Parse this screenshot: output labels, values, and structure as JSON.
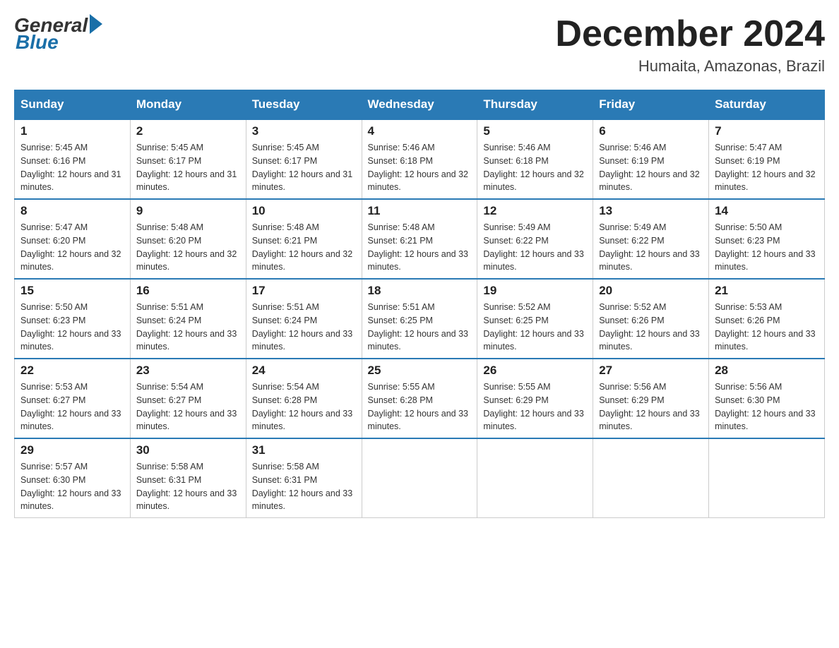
{
  "header": {
    "logo": {
      "general": "General",
      "blue": "Blue"
    },
    "title": "December 2024",
    "location": "Humaita, Amazonas, Brazil"
  },
  "calendar": {
    "days_of_week": [
      "Sunday",
      "Monday",
      "Tuesday",
      "Wednesday",
      "Thursday",
      "Friday",
      "Saturday"
    ],
    "weeks": [
      [
        {
          "day": "1",
          "sunrise": "5:45 AM",
          "sunset": "6:16 PM",
          "daylight": "12 hours and 31 minutes."
        },
        {
          "day": "2",
          "sunrise": "5:45 AM",
          "sunset": "6:17 PM",
          "daylight": "12 hours and 31 minutes."
        },
        {
          "day": "3",
          "sunrise": "5:45 AM",
          "sunset": "6:17 PM",
          "daylight": "12 hours and 31 minutes."
        },
        {
          "day": "4",
          "sunrise": "5:46 AM",
          "sunset": "6:18 PM",
          "daylight": "12 hours and 32 minutes."
        },
        {
          "day": "5",
          "sunrise": "5:46 AM",
          "sunset": "6:18 PM",
          "daylight": "12 hours and 32 minutes."
        },
        {
          "day": "6",
          "sunrise": "5:46 AM",
          "sunset": "6:19 PM",
          "daylight": "12 hours and 32 minutes."
        },
        {
          "day": "7",
          "sunrise": "5:47 AM",
          "sunset": "6:19 PM",
          "daylight": "12 hours and 32 minutes."
        }
      ],
      [
        {
          "day": "8",
          "sunrise": "5:47 AM",
          "sunset": "6:20 PM",
          "daylight": "12 hours and 32 minutes."
        },
        {
          "day": "9",
          "sunrise": "5:48 AM",
          "sunset": "6:20 PM",
          "daylight": "12 hours and 32 minutes."
        },
        {
          "day": "10",
          "sunrise": "5:48 AM",
          "sunset": "6:21 PM",
          "daylight": "12 hours and 32 minutes."
        },
        {
          "day": "11",
          "sunrise": "5:48 AM",
          "sunset": "6:21 PM",
          "daylight": "12 hours and 33 minutes."
        },
        {
          "day": "12",
          "sunrise": "5:49 AM",
          "sunset": "6:22 PM",
          "daylight": "12 hours and 33 minutes."
        },
        {
          "day": "13",
          "sunrise": "5:49 AM",
          "sunset": "6:22 PM",
          "daylight": "12 hours and 33 minutes."
        },
        {
          "day": "14",
          "sunrise": "5:50 AM",
          "sunset": "6:23 PM",
          "daylight": "12 hours and 33 minutes."
        }
      ],
      [
        {
          "day": "15",
          "sunrise": "5:50 AM",
          "sunset": "6:23 PM",
          "daylight": "12 hours and 33 minutes."
        },
        {
          "day": "16",
          "sunrise": "5:51 AM",
          "sunset": "6:24 PM",
          "daylight": "12 hours and 33 minutes."
        },
        {
          "day": "17",
          "sunrise": "5:51 AM",
          "sunset": "6:24 PM",
          "daylight": "12 hours and 33 minutes."
        },
        {
          "day": "18",
          "sunrise": "5:51 AM",
          "sunset": "6:25 PM",
          "daylight": "12 hours and 33 minutes."
        },
        {
          "day": "19",
          "sunrise": "5:52 AM",
          "sunset": "6:25 PM",
          "daylight": "12 hours and 33 minutes."
        },
        {
          "day": "20",
          "sunrise": "5:52 AM",
          "sunset": "6:26 PM",
          "daylight": "12 hours and 33 minutes."
        },
        {
          "day": "21",
          "sunrise": "5:53 AM",
          "sunset": "6:26 PM",
          "daylight": "12 hours and 33 minutes."
        }
      ],
      [
        {
          "day": "22",
          "sunrise": "5:53 AM",
          "sunset": "6:27 PM",
          "daylight": "12 hours and 33 minutes."
        },
        {
          "day": "23",
          "sunrise": "5:54 AM",
          "sunset": "6:27 PM",
          "daylight": "12 hours and 33 minutes."
        },
        {
          "day": "24",
          "sunrise": "5:54 AM",
          "sunset": "6:28 PM",
          "daylight": "12 hours and 33 minutes."
        },
        {
          "day": "25",
          "sunrise": "5:55 AM",
          "sunset": "6:28 PM",
          "daylight": "12 hours and 33 minutes."
        },
        {
          "day": "26",
          "sunrise": "5:55 AM",
          "sunset": "6:29 PM",
          "daylight": "12 hours and 33 minutes."
        },
        {
          "day": "27",
          "sunrise": "5:56 AM",
          "sunset": "6:29 PM",
          "daylight": "12 hours and 33 minutes."
        },
        {
          "day": "28",
          "sunrise": "5:56 AM",
          "sunset": "6:30 PM",
          "daylight": "12 hours and 33 minutes."
        }
      ],
      [
        {
          "day": "29",
          "sunrise": "5:57 AM",
          "sunset": "6:30 PM",
          "daylight": "12 hours and 33 minutes."
        },
        {
          "day": "30",
          "sunrise": "5:58 AM",
          "sunset": "6:31 PM",
          "daylight": "12 hours and 33 minutes."
        },
        {
          "day": "31",
          "sunrise": "5:58 AM",
          "sunset": "6:31 PM",
          "daylight": "12 hours and 33 minutes."
        },
        null,
        null,
        null,
        null
      ]
    ]
  }
}
